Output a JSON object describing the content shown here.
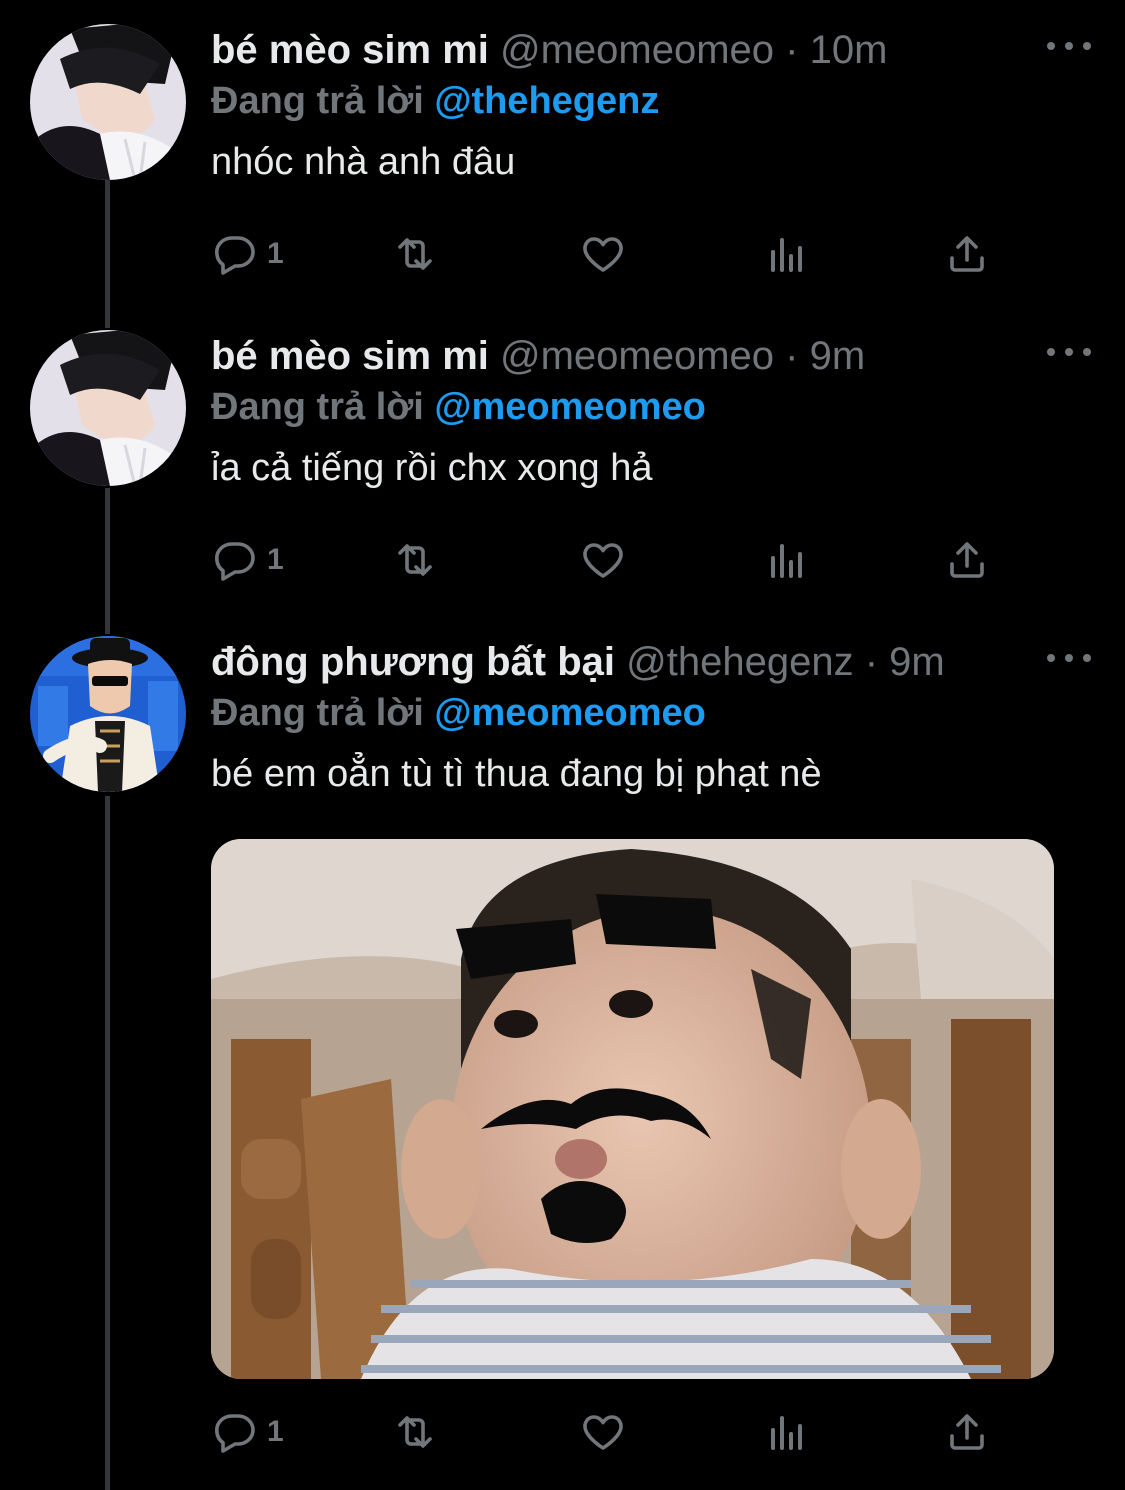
{
  "tweets": [
    {
      "name": "bé mèo sim mi",
      "handle": "@meomeomeo",
      "separator": "·",
      "time": "10m",
      "reply_prefix": "Đang trả lời",
      "reply_to": "@thehegenz",
      "text": "nhóc nhà anh đâu",
      "reply_count": "1"
    },
    {
      "name": "bé mèo sim mi",
      "handle": "@meomeomeo",
      "separator": "·",
      "time": "9m",
      "reply_prefix": "Đang trả lời",
      "reply_to": "@meomeomeo",
      "text": "ỉa cả tiếng rồi chx xong hả",
      "reply_count": "1"
    },
    {
      "name": "đông phương bất bại",
      "handle": "@thehegenz",
      "separator": "·",
      "time": "9m",
      "reply_prefix": "Đang trả lời",
      "reply_to": "@meomeomeo",
      "text": "bé em oẳn tù tì thua đang bị phạt nè",
      "reply_count": "1",
      "media": "photo of a baby with drawn-on eyebrows, moustache and goatee"
    }
  ],
  "icons": {
    "reply": "reply-bubble-icon",
    "retweet": "retweet-icon",
    "like": "heart-icon",
    "views": "views-bar-icon",
    "share": "share-icon",
    "more": "more-dots-icon"
  },
  "colors": {
    "background": "#000000",
    "text": "#e7e9ea",
    "secondary": "#71767b",
    "accent": "#1d9bf0",
    "thread_line": "#333639"
  }
}
